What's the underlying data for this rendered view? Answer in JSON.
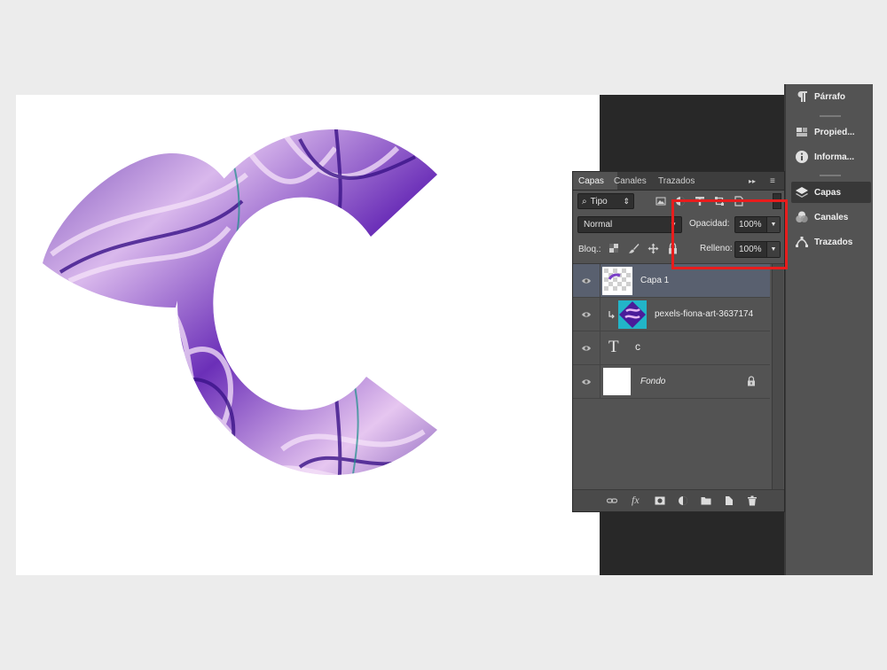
{
  "dock": {
    "items": [
      {
        "label": "Párrafo",
        "icon": "paragraph-icon"
      },
      {
        "label": "Propied...",
        "icon": "properties-icon"
      },
      {
        "label": "Informa...",
        "icon": "info-icon"
      },
      {
        "label": "Capas",
        "icon": "layers-icon"
      },
      {
        "label": "Canales",
        "icon": "channels-icon"
      },
      {
        "label": "Trazados",
        "icon": "paths-icon"
      }
    ]
  },
  "panel": {
    "tabs": [
      "Capas",
      "Canales",
      "Trazados"
    ],
    "expand_glyph": "▸▸",
    "menu_glyph": "≡",
    "filter": {
      "label": "Tipo",
      "search_glyph": "⌕",
      "arrows_glyph": "⇕"
    },
    "blend_mode": "Normal",
    "opacity_label": "Opacidad:",
    "opacity_value": "100%",
    "fill_label": "Relleno:",
    "fill_value": "100%",
    "lock_label": "Bloq.:",
    "layers": [
      {
        "name": "Capa 1",
        "selected": true
      },
      {
        "name": "pexels-fiona-art-3637174",
        "clipped": true
      },
      {
        "name": "c",
        "type_glyph": "T"
      },
      {
        "name": "Fondo",
        "locked": true
      }
    ]
  },
  "colors": {
    "highlight": "#e81d1d",
    "selected_layer": "#59606f",
    "panel_bg": "#535353"
  }
}
